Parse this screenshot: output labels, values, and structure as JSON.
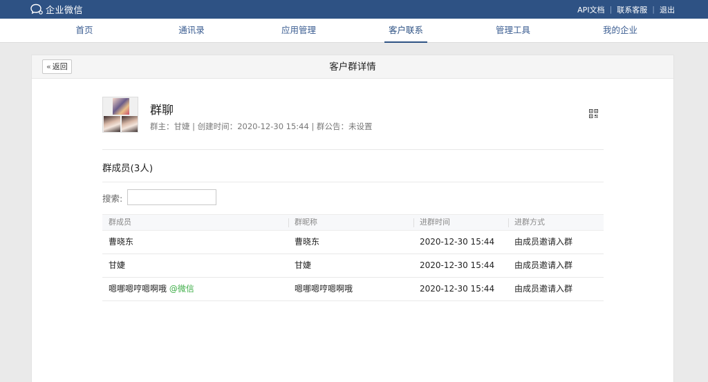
{
  "topbar": {
    "logo_text": "企业微信",
    "links": [
      "API文档",
      "联系客服",
      "退出"
    ]
  },
  "nav": {
    "items": [
      "首页",
      "通讯录",
      "应用管理",
      "客户联系",
      "管理工具",
      "我的企业"
    ],
    "active_index": 3
  },
  "panel": {
    "back_label": "返回",
    "title": "客户群详情"
  },
  "group": {
    "name": "群聊",
    "owner_label": "群主：",
    "owner": "甘婕",
    "created_label": "创建时间：",
    "created": "2020-12-30 15:44",
    "notice_label": "群公告：",
    "notice": "未设置"
  },
  "members": {
    "title": "群成员(3人)",
    "search_label": "搜索:",
    "search_value": "",
    "columns": [
      "群成员",
      "群昵称",
      "进群时间",
      "进群方式"
    ],
    "rows": [
      {
        "member": "曹晓东",
        "tag": "",
        "nickname": "曹晓东",
        "join_time": "2020-12-30 15:44",
        "join_method": "由成员邀请入群"
      },
      {
        "member": "甘婕",
        "tag": "",
        "nickname": "甘婕",
        "join_time": "2020-12-30 15:44",
        "join_method": "由成员邀请入群"
      },
      {
        "member": "嗯哪嗯哼嗯啊哦",
        "tag": "@微信",
        "nickname": "嗯哪嗯哼嗯啊哦",
        "join_time": "2020-12-30 15:44",
        "join_method": "由成员邀请入群"
      }
    ]
  },
  "colors": {
    "topbar_bg": "#2e5284",
    "nav_text": "#3c5e92",
    "wechat_tag": "#3fae49"
  },
  "icons": {
    "logo": "wecom-chat-bubble-icon",
    "back": "double-chevron-left-icon",
    "qrcode": "qrcode-icon"
  }
}
